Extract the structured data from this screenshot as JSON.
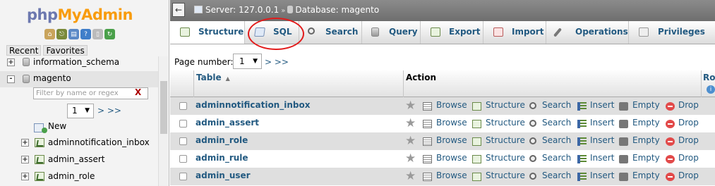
{
  "logo": {
    "part1": "php",
    "part2": "MyAdmin"
  },
  "nav": {
    "tab_recent": "Recent",
    "tab_favorites": "Favorites",
    "databases": [
      {
        "name": "information_schema",
        "state": "+"
      },
      {
        "name": "magento",
        "state": "-"
      }
    ],
    "filter_placeholder": "Filter by name or regex",
    "filter_clear": "X",
    "page_value": "1",
    "page_next": "> >>",
    "new_label": "New",
    "tables": [
      "adminnotification_inbox",
      "admin_assert",
      "admin_role"
    ]
  },
  "breadcrumb": {
    "server": "Server: 127.0.0.1",
    "separator": "»",
    "database": "Database: magento"
  },
  "tabs": [
    {
      "label": "Structure",
      "icon": "structure-icon"
    },
    {
      "label": "SQL",
      "icon": "sql-icon"
    },
    {
      "label": "Search",
      "icon": "search-icon"
    },
    {
      "label": "Query",
      "icon": "query-icon"
    },
    {
      "label": "Export",
      "icon": "export-icon"
    },
    {
      "label": "Import",
      "icon": "import-icon"
    },
    {
      "label": "Operations",
      "icon": "wrench-icon"
    },
    {
      "label": "Privileges",
      "icon": "privileges-icon"
    }
  ],
  "pagination": {
    "label": "Page number:",
    "value": "1",
    "next": "> >>"
  },
  "table_header": {
    "table": "Table",
    "action": "Action",
    "rows_partial": "Ro"
  },
  "actions": {
    "browse": "Browse",
    "structure": "Structure",
    "search": "Search",
    "insert": "Insert",
    "empty": "Empty",
    "drop": "Drop"
  },
  "rows": [
    {
      "name": "adminnotification_inbox"
    },
    {
      "name": "admin_assert"
    },
    {
      "name": "admin_role"
    },
    {
      "name": "admin_rule"
    },
    {
      "name": "admin_user"
    }
  ],
  "colors": {
    "link": "#235a81",
    "highlight_circle": "#e21b1b",
    "logo_php": "#6c78af",
    "logo_myadmin": "#f89c0e"
  }
}
